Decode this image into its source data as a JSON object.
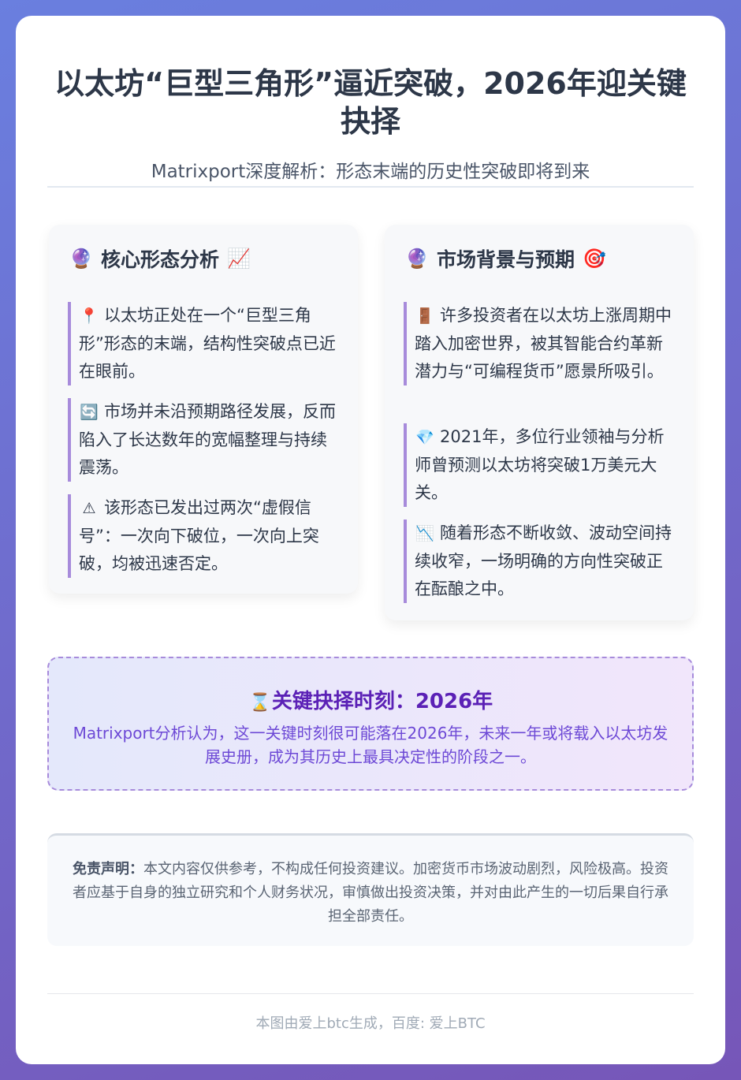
{
  "header": {
    "title": "以太坊“巨型三角形”逼近突破，2026年迎关键抉择",
    "subtitle": "Matrixport深度解析：形态末端的历史性突破即将到来"
  },
  "left_panel": {
    "icon": "crystal-ball-icon",
    "title": "核心形态分析",
    "trail_icon": "chart-increasing-icon",
    "items": [
      {
        "icon": "round-pushpin-icon",
        "text": "以太坊正处在一个“巨型三角形”形态的末端，结构性突破点已近在眼前。"
      },
      {
        "icon": "counterclockwise-arrows-icon",
        "text": "市场并未沿预期路径发展，反而陷入了长达数年的宽幅整理与持续震荡。"
      },
      {
        "icon": "warning-icon",
        "text": "该形态已发出过两次“虚假信号”：一次向下破位，一次向上突破，均被迅速否定。"
      }
    ]
  },
  "right_panel": {
    "icon": "crystal-ball-icon",
    "title": "市场背景与预期",
    "trail_icon": "direct-hit-icon",
    "items": [
      {
        "icon": "door-icon",
        "text": "许多投资者在以太坊上涨周期中踏入加密世界，被其智能合约革新潜力与“可编程货币”愿景所吸引。"
      },
      {
        "icon": "gem-stone-icon",
        "text": "2021年，多位行业领袖与分析师曾预测以太坊将突破1万美元大关。"
      },
      {
        "icon": "chart-decreasing-icon",
        "text": "随着形态不断收敛、波动空间持续收窄，一场明确的方向性突破正在酝酿之中。"
      }
    ]
  },
  "highlight": {
    "icon": "hourglass-icon",
    "title": "关键抉择时刻：2026年",
    "body": "Matrixport分析认为，这一关键时刻很可能落在2026年，未来一年或将载入以太坊发展史册，成为其历史上最具决定性的阶段之一。"
  },
  "disclaimer": {
    "label": "免责声明：",
    "text": "本文内容仅供参考，不构成任何投资建议。加密货币市场波动剧烈，风险极高。投资者应基于自身的独立研究和个人财务状况，审慎做出投资决策，并对由此产生的一切后果自行承担全部责任。"
  },
  "footer": {
    "text": "本图由爱上btc生成，百度: 爱上BTC"
  }
}
